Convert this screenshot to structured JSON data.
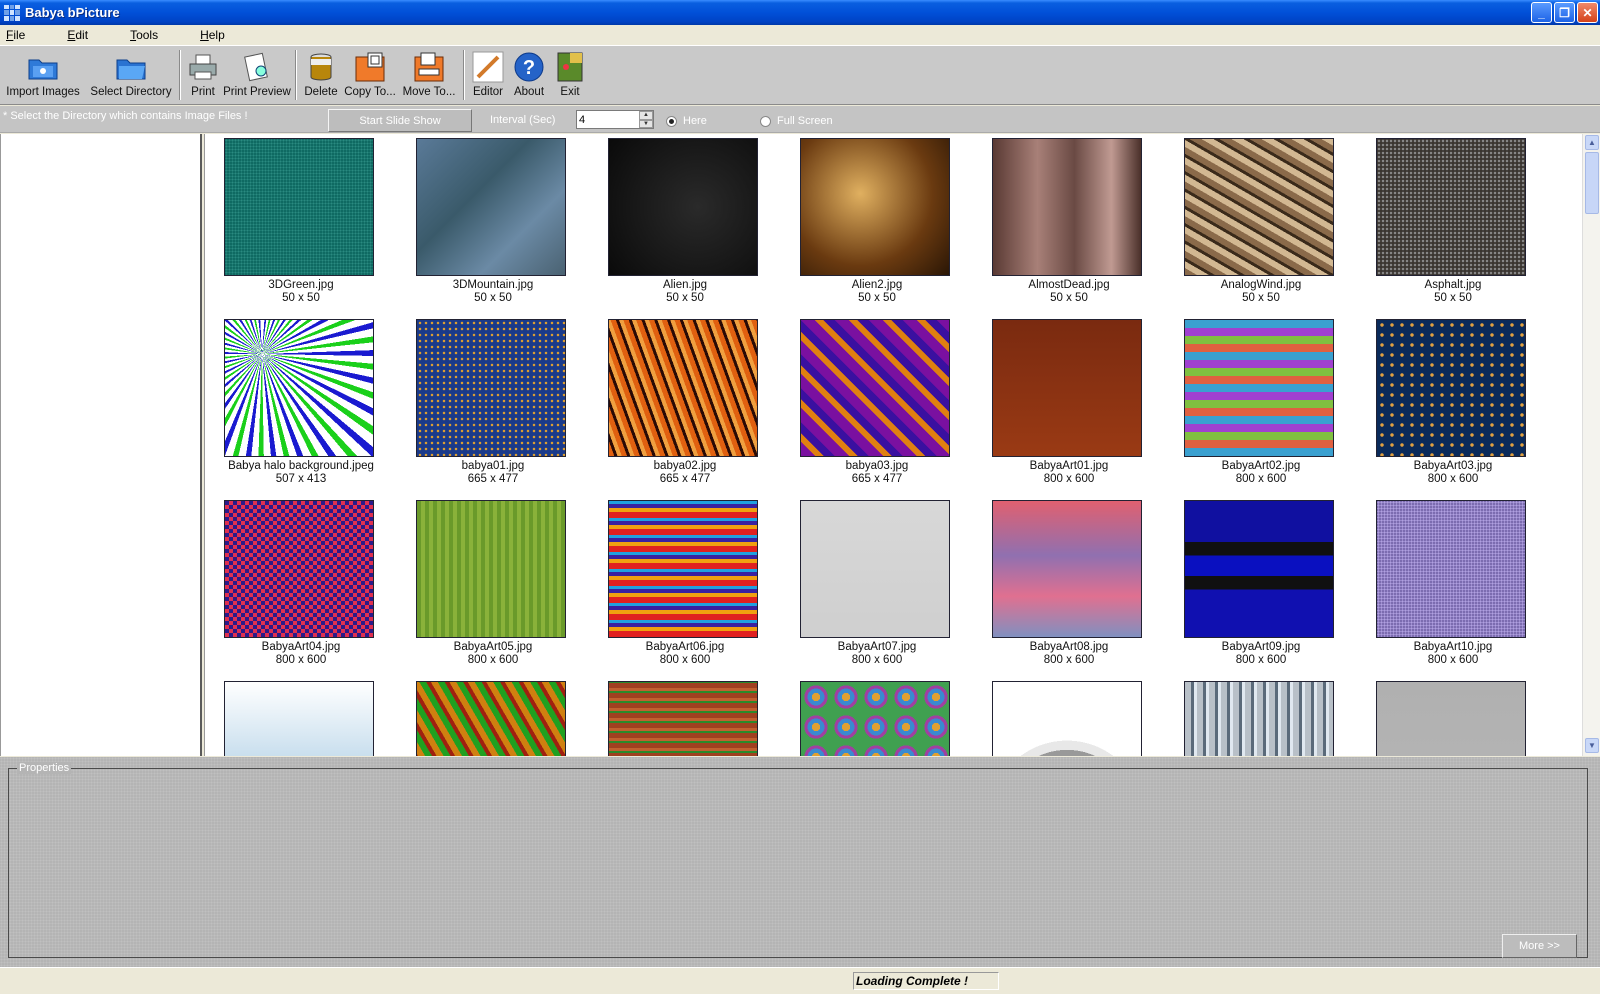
{
  "window": {
    "title": "Babya bPicture"
  },
  "menu": [
    "File",
    "Edit",
    "Tools",
    "Help"
  ],
  "toolbar": [
    {
      "label": "Import Images",
      "icon": "import-images-icon"
    },
    {
      "label": "Select Directory",
      "icon": "select-directory-icon"
    },
    {
      "label": "Print",
      "icon": "print-icon"
    },
    {
      "label": "Print Preview",
      "icon": "print-preview-icon"
    },
    {
      "label": "Delete",
      "icon": "delete-icon"
    },
    {
      "label": "Copy To...",
      "icon": "copy-to-icon"
    },
    {
      "label": "Move To...",
      "icon": "move-to-icon"
    },
    {
      "label": "Editor",
      "icon": "editor-icon"
    },
    {
      "label": "About",
      "icon": "about-icon"
    },
    {
      "label": "Exit",
      "icon": "exit-icon"
    }
  ],
  "slideshow": {
    "hint": "* Select the Directory which contains Image Files !",
    "start_label": "Start Slide Show",
    "interval_label": "Interval (Sec)",
    "interval_value": "4",
    "here_label": "Here",
    "fullscreen_label": "Full Screen",
    "selected_mode": "Here"
  },
  "thumbnails": [
    {
      "name": "3DGreen.jpg",
      "size": "50 x 50"
    },
    {
      "name": "3DMountain.jpg",
      "size": "50 x 50"
    },
    {
      "name": "Alien.jpg",
      "size": "50 x 50"
    },
    {
      "name": "Alien2.jpg",
      "size": "50 x 50"
    },
    {
      "name": "AlmostDead.jpg",
      "size": "50 x 50"
    },
    {
      "name": "AnalogWind.jpg",
      "size": "50 x 50"
    },
    {
      "name": "Asphalt.jpg",
      "size": "50 x 50"
    },
    {
      "name": "Babya halo background.jpeg",
      "size": "507 x 413"
    },
    {
      "name": "babya01.jpg",
      "size": "665 x 477"
    },
    {
      "name": "babya02.jpg",
      "size": "665 x 477"
    },
    {
      "name": "babya03.jpg",
      "size": "665 x 477"
    },
    {
      "name": "BabyaArt01.jpg",
      "size": "800 x 600"
    },
    {
      "name": "BabyaArt02.jpg",
      "size": "800 x 600"
    },
    {
      "name": "BabyaArt03.jpg",
      "size": "800 x 600"
    },
    {
      "name": "BabyaArt04.jpg",
      "size": "800 x 600"
    },
    {
      "name": "BabyaArt05.jpg",
      "size": "800 x 600"
    },
    {
      "name": "BabyaArt06.jpg",
      "size": "800 x 600"
    },
    {
      "name": "BabyaArt07.jpg",
      "size": "800 x 600"
    },
    {
      "name": "BabyaArt08.jpg",
      "size": "800 x 600"
    },
    {
      "name": "BabyaArt09.jpg",
      "size": "800 x 600"
    },
    {
      "name": "BabyaArt10.jpg",
      "size": "800 x 600"
    },
    {
      "name": "",
      "size": ""
    },
    {
      "name": "",
      "size": ""
    },
    {
      "name": "",
      "size": ""
    },
    {
      "name": "",
      "size": ""
    },
    {
      "name": "",
      "size": ""
    },
    {
      "name": "",
      "size": ""
    },
    {
      "name": "",
      "size": ""
    }
  ],
  "properties": {
    "legend": "Properties",
    "more_label": "More >>"
  },
  "status": {
    "text": "Loading Complete !"
  }
}
